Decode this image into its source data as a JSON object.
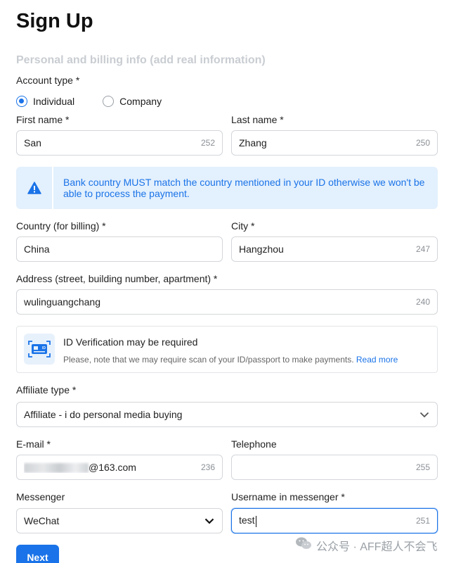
{
  "page": {
    "title": "Sign Up",
    "section_subtitle": "Personal and billing info (add real information)"
  },
  "account_type": {
    "label": "Account type *",
    "options": [
      "Individual",
      "Company"
    ],
    "selected": "Individual"
  },
  "first_name": {
    "label": "First name *",
    "value": "San",
    "remaining": "252"
  },
  "last_name": {
    "label": "Last name *",
    "value": "Zhang",
    "remaining": "250"
  },
  "alert": {
    "line1": "Bank country MUST match the country mentioned in your ID otherwise we won't be",
    "line2": "able to process the payment.",
    "icon": "warning-icon"
  },
  "country": {
    "label": "Country (for billing) *",
    "value": "China"
  },
  "city": {
    "label": "City *",
    "value": "Hangzhou",
    "remaining": "247"
  },
  "address": {
    "label": "Address (street, building number, apartment) *",
    "value": "wulinguangchang",
    "remaining": "240"
  },
  "id_verification": {
    "title": "ID Verification may be required",
    "note": "Please, note that we may require scan of your ID/passport to make payments.",
    "link": "Read more",
    "icon": "id-card-icon"
  },
  "affiliate_type": {
    "label": "Affiliate type *",
    "value": "Affiliate - i do personal media buying"
  },
  "email": {
    "label": "E-mail *",
    "value_suffix": "@163.com",
    "remaining": "236"
  },
  "telephone": {
    "label": "Telephone",
    "value": "",
    "remaining": "255"
  },
  "messenger": {
    "label": "Messenger",
    "value": "WeChat"
  },
  "messenger_username": {
    "label": "Username in messenger *",
    "value": "test",
    "remaining": "251"
  },
  "actions": {
    "next_label": "Next"
  },
  "watermark": {
    "text": "公众号 · AFF超人不会飞",
    "icon": "wechat-icon"
  },
  "colors": {
    "accent": "#1a73e8",
    "alert_bg": "#e3f0fd",
    "border": "#d3d6da"
  }
}
